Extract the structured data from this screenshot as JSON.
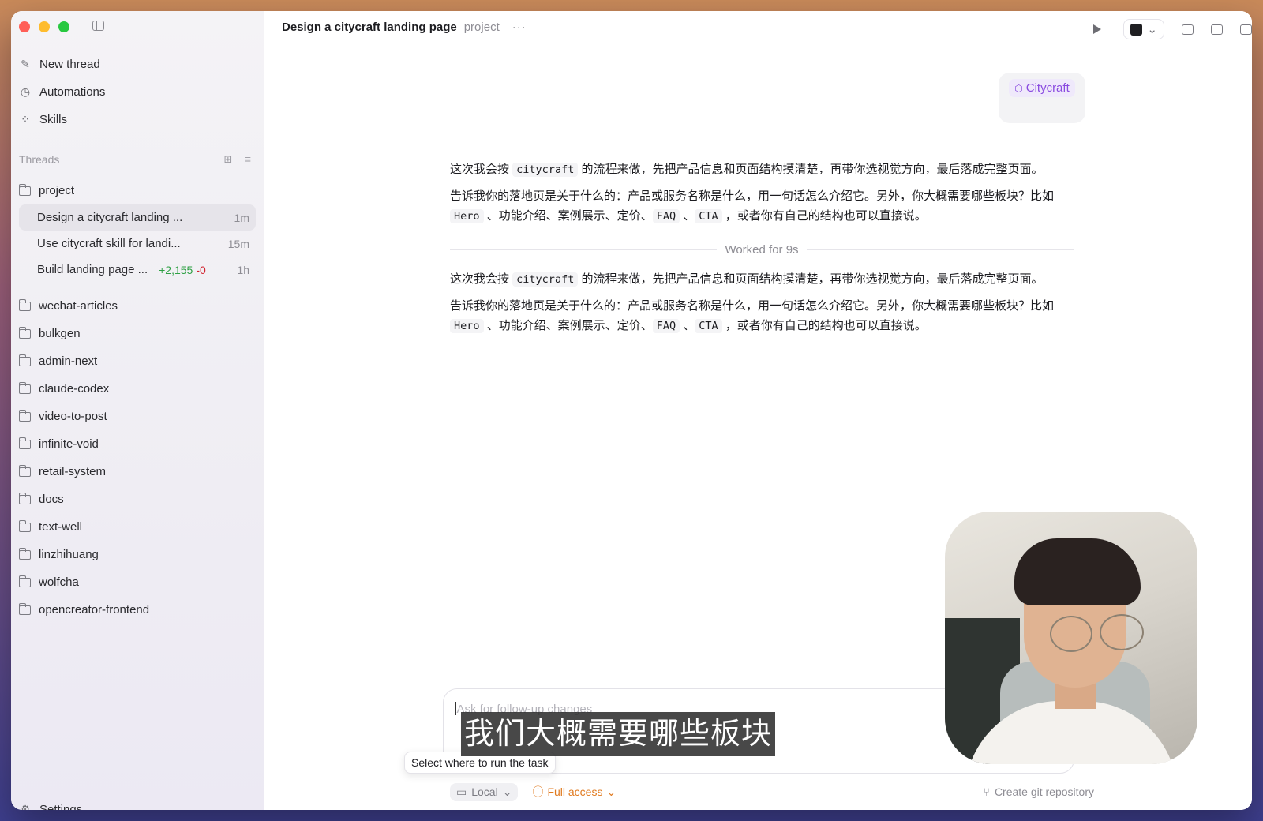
{
  "sidebar": {
    "nav": [
      {
        "label": "New thread",
        "icon": "compose-icon"
      },
      {
        "label": "Automations",
        "icon": "clock-icon"
      },
      {
        "label": "Skills",
        "icon": "grid-icon"
      }
    ],
    "threads_header": "Threads",
    "project": {
      "label": "project",
      "threads": [
        {
          "title": "Design a citycraft landing ...",
          "time": "1m"
        },
        {
          "title": "Use citycraft skill for landi...",
          "time": "15m"
        },
        {
          "title": "Build landing page ...",
          "diff_add": "+2,155",
          "diff_del": "-0",
          "time": "1h"
        }
      ]
    },
    "folders": [
      "wechat-articles",
      "bulkgen",
      "admin-next",
      "claude-codex",
      "video-to-post",
      "infinite-void",
      "retail-system",
      "docs",
      "text-well",
      "linzhihuang",
      "wolfcha",
      "opencreator-frontend"
    ],
    "settings_label": "Settings"
  },
  "header": {
    "title": "Design a citycraft landing page",
    "project": "project",
    "more": "···"
  },
  "chat": {
    "user_chip": "Citycraft",
    "messages": [
      {
        "line1_pre": "这次我会按 ",
        "line1_code": "citycraft",
        "line1_post": " 的流程来做，先把产品信息和页面结构摸清楚，再带你选视觉方向，最后落成完整页面。",
        "line2_a": "告诉我你的落地页是关于什么的：产品或服务名称是什么，用一句话怎么介绍它。另外，你大概需要哪些板块？比如",
        "code_hero": "Hero",
        "line2_b": " 、功能介绍、案例展示、定价、",
        "code_faq": "FAQ",
        "line2_c": " 、",
        "code_cta": "CTA",
        "line2_d": " ，或者你有自己的结构也可以直接说。"
      },
      {
        "line1_pre": "这次我会按 ",
        "line1_code": "citycraft",
        "line1_post": " 的流程来做，先把产品信息和页面结构摸清楚，再带你选视觉方向，最后落成完整页面。",
        "line2_a": "告诉我你的落地页是关于什么的：产品或服务名称是什么，用一句话怎么介绍它。另外，你大概需要哪些板块？比如",
        "code_hero": "Hero",
        "line2_b": " 、功能介绍、案例展示、定价、",
        "code_faq": "FAQ",
        "line2_c": " 、",
        "code_cta": "CTA",
        "line2_d": " ，或者你有自己的结构也可以直接说。"
      }
    ],
    "worked": "Worked for 9s"
  },
  "composer": {
    "placeholder": "Ask for follow-up changes",
    "tooltip": "Select where to run the task",
    "local_label": "Local",
    "access_label": "Full access",
    "git_label": "Create git repository"
  },
  "subtitle": "我们大概需要哪些板块",
  "colors": {
    "accent_purple": "#8a4be0",
    "warning_orange": "#e07a1f",
    "diff_add": "#2ea043",
    "diff_del": "#d1242f"
  }
}
